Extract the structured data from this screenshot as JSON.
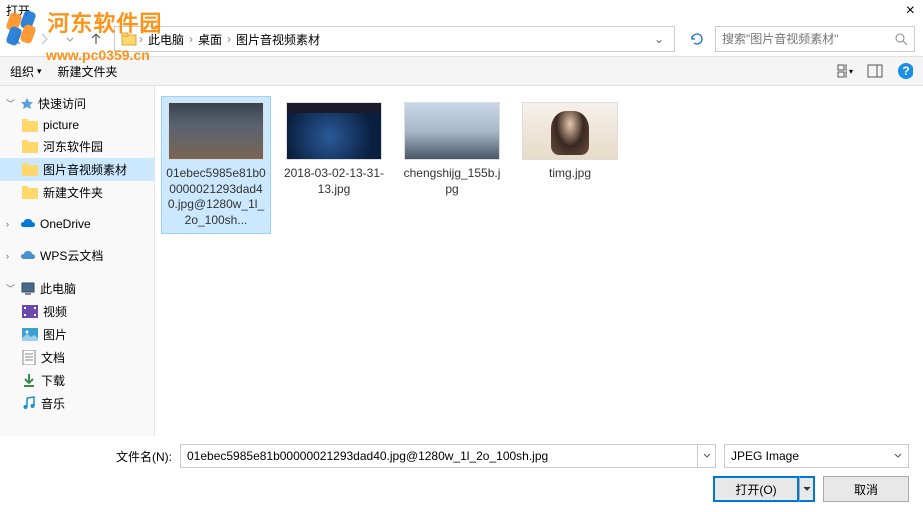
{
  "window": {
    "title": "打开"
  },
  "watermark": {
    "line1": "河东软件园",
    "line2": "www.pc0359.cn"
  },
  "breadcrumb": {
    "items": [
      "此电脑",
      "桌面",
      "图片音视频素材"
    ]
  },
  "search": {
    "placeholder": "搜索\"图片音视频素材\""
  },
  "toolbar": {
    "organize": "组织",
    "newfolder": "新建文件夹"
  },
  "sidebar": {
    "quickaccess": {
      "label": "快速访问",
      "items": [
        "picture",
        "河东软件园",
        "图片音视频素材",
        "新建文件夹"
      ]
    },
    "onedrive": "OneDrive",
    "wps": "WPS云文档",
    "thispc": {
      "label": "此电脑",
      "items": [
        "视频",
        "图片",
        "文档",
        "下载",
        "音乐"
      ]
    }
  },
  "files": [
    {
      "name": "01ebec5985e81b00000021293dad40.jpg@1280w_1l_2o_100sh..."
    },
    {
      "name": "2018-03-02-13-31-13.jpg"
    },
    {
      "name": "chengshijg_155b.jpg"
    },
    {
      "name": "timg.jpg"
    }
  ],
  "footer": {
    "filename_label": "文件名(N):",
    "filename_value": "01ebec5985e81b00000021293dad40.jpg@1280w_1l_2o_100sh.jpg",
    "filetype": "JPEG Image",
    "open": "打开(O)",
    "cancel": "取消"
  }
}
